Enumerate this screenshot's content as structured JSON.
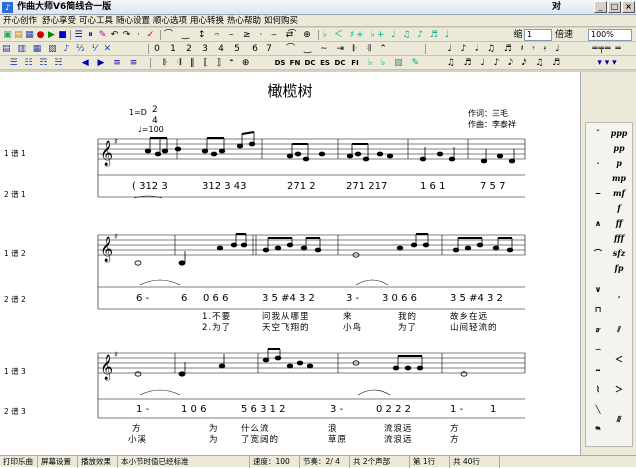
{
  "window": {
    "title": "作曲大师V6简线合一版",
    "title_right": "对",
    "minimize": "_",
    "maximize": "□",
    "close": "×"
  },
  "menu": [
    "开心创作",
    "舒心享受",
    "可心工具",
    "随心设置",
    "顺心选项",
    "用心转换",
    "热心帮助",
    "如何购买"
  ],
  "toolbar": {
    "row2": [
      "0",
      "1",
      "2",
      "3",
      "4",
      "5",
      "6",
      "7"
    ],
    "row3": [
      "DS",
      "FN",
      "DC",
      "ES",
      "DC",
      "FI"
    ],
    "zoom_label": "缩",
    "zoom_value": "1",
    "zoom_suffix": "倍速",
    "percent": "100%"
  },
  "score": {
    "title": "橄榄树",
    "key": "1=D",
    "time_top": "2",
    "time_bottom": "4",
    "tempo": "♩=100",
    "lyricist": "作词：三毛",
    "composer": "作曲：李泰祥",
    "tracks": [
      {
        "label": "1 谱 1"
      },
      {
        "label": "2 谱 1"
      },
      {
        "label": "1 谱 2"
      },
      {
        "label": "2 谱 2"
      },
      {
        "label": "1 谱 3"
      },
      {
        "label": "2 谱 3"
      }
    ],
    "jianpu": {
      "line1": [
        "( 312 3",
        "312 3 43",
        "271 2",
        "271 217",
        "1 6 1",
        "7 5 7"
      ],
      "line2": [
        "6 -",
        "6",
        "0 6 6",
        "3 5 #4 3 2",
        "3 -",
        "3 0 6 6",
        "3 5 #4 3 2"
      ],
      "line3": [
        "1 -",
        "1 0 6",
        "5 6 3 1 2",
        "3 -",
        "0 2 2 2",
        "1 -",
        "1"
      ]
    },
    "lyrics": {
      "l2a": [
        "1.不要",
        "问我从哪里",
        "来",
        "我的",
        "故乡在远"
      ],
      "l2b": [
        "2.为了",
        "天空飞翔的",
        "小鸟",
        "为了",
        "山间轻流的"
      ],
      "l3a": [
        "方",
        "为",
        "什么流",
        "浪",
        "流浪远",
        "方"
      ],
      "l3b": [
        "小溪",
        "为",
        "了宽阔的",
        "草原",
        "流浪远",
        "方"
      ]
    }
  },
  "palette": [
    "ppp",
    "pp",
    "p",
    "mp",
    "mf",
    "f",
    "ff",
    "fff",
    "sfz",
    "fp"
  ],
  "status": {
    "print": "打印乐曲",
    "screen": "屏幕设置",
    "effect": "播放效果",
    "note": "本小节时值已经标准",
    "speed": "速度：100",
    "beat": "节奏：2/ 4",
    "voices": "共 2个声部",
    "line": "第 1行",
    "total": "共 40行"
  }
}
